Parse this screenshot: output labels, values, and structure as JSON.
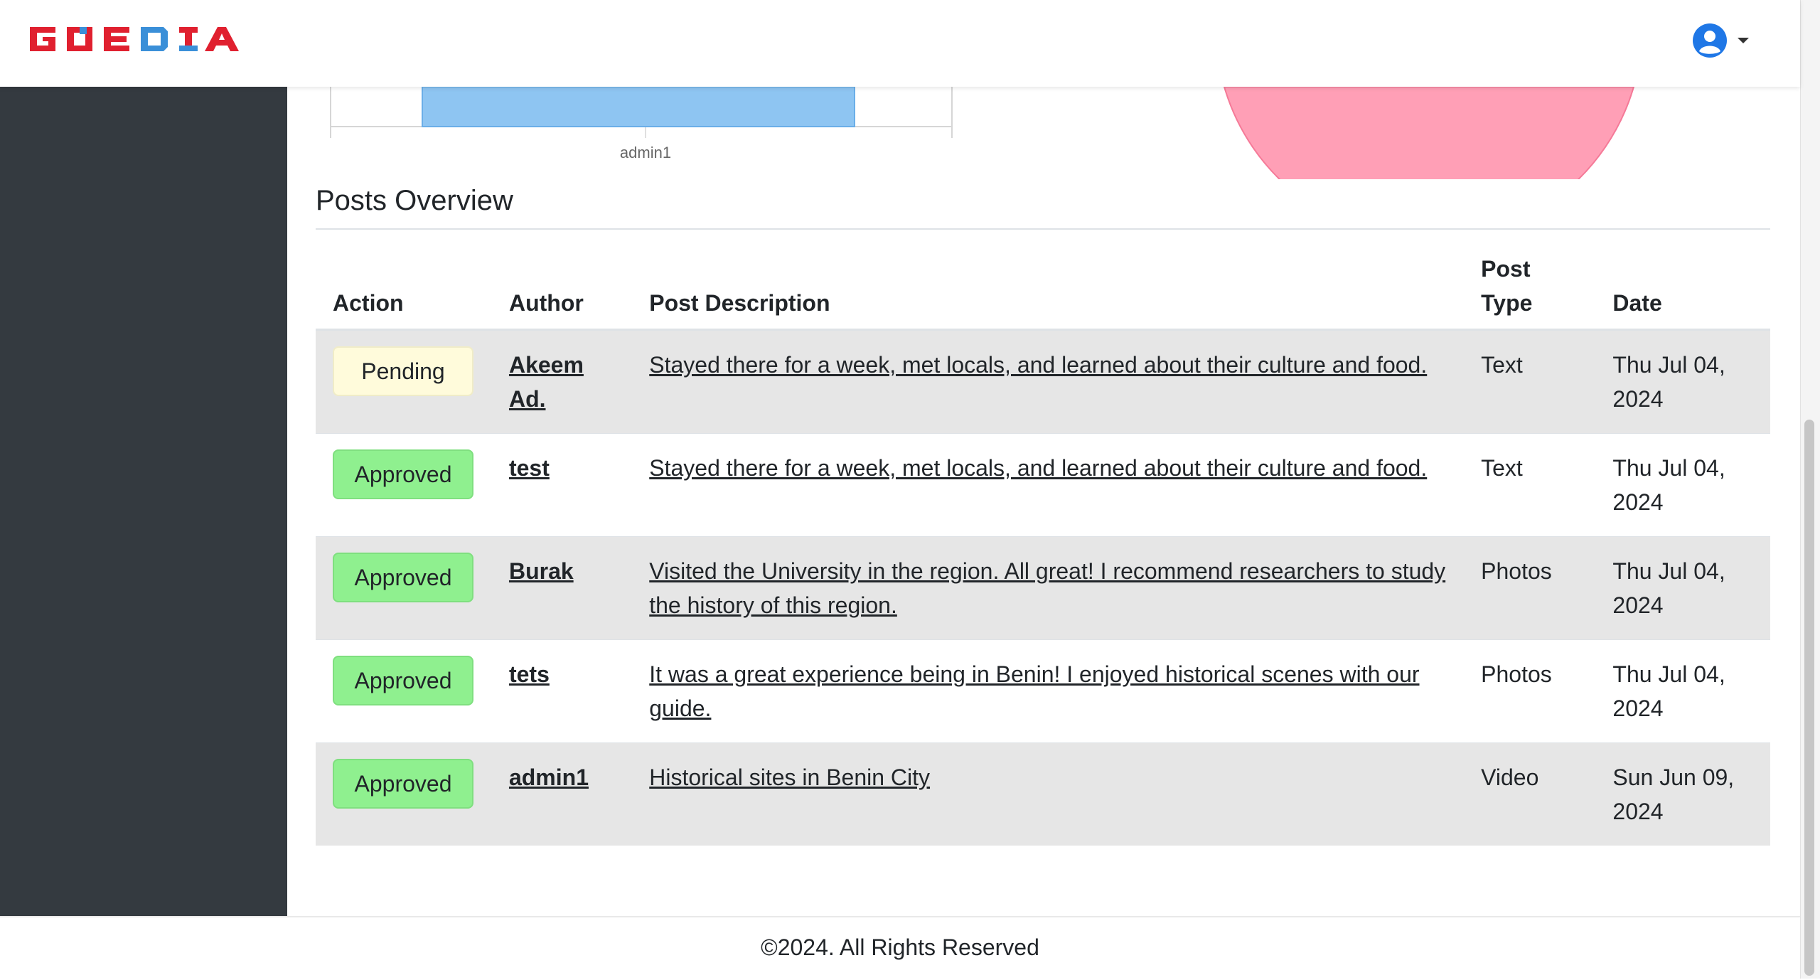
{
  "navbar": {
    "logo_text": "GOEDIA",
    "brand_colors": {
      "red": "#e0202f",
      "blue": "#3a8fd8"
    },
    "user_icon": "user-circle-icon",
    "dropdown_icon": "caret-down-icon"
  },
  "bar_chart": {
    "type": "bar",
    "categories": [
      "admin1"
    ],
    "y_tick_visible": "0",
    "bar_color": "#8ec5f2"
  },
  "pie_chart": {
    "type": "pie",
    "slice_color": "#ff9fb6"
  },
  "section": {
    "title": "Posts Overview"
  },
  "table": {
    "headers": {
      "action": "Action",
      "author": "Author",
      "description": "Post Description",
      "type": "Post Type",
      "date": "Date"
    },
    "rows": [
      {
        "status": "Pending",
        "author": "Akeem Ad.",
        "description": "Stayed there for a week, met locals, and learned about their culture and food.",
        "type": "Text",
        "date": "Thu Jul 04, 2024"
      },
      {
        "status": "Approved",
        "author": "test",
        "description": "Stayed there for a week, met locals, and learned about their culture and food.",
        "type": "Text",
        "date": "Thu Jul 04, 2024"
      },
      {
        "status": "Approved",
        "author": "Burak",
        "description": "Visited the University in the region. All great! I recommend researchers to study the history of this region.",
        "type": "Photos",
        "date": "Thu Jul 04, 2024"
      },
      {
        "status": "Approved",
        "author": "tets",
        "description": "It was a great experience being in Benin! I enjoyed historical scenes with our guide.",
        "type": "Photos",
        "date": "Thu Jul 04, 2024"
      },
      {
        "status": "Approved",
        "author": "admin1",
        "description": "Historical sites in Benin City",
        "type": "Video",
        "date": "Sun Jun 09, 2024"
      }
    ]
  },
  "footer": {
    "text": "©2024. All Rights Reserved"
  }
}
